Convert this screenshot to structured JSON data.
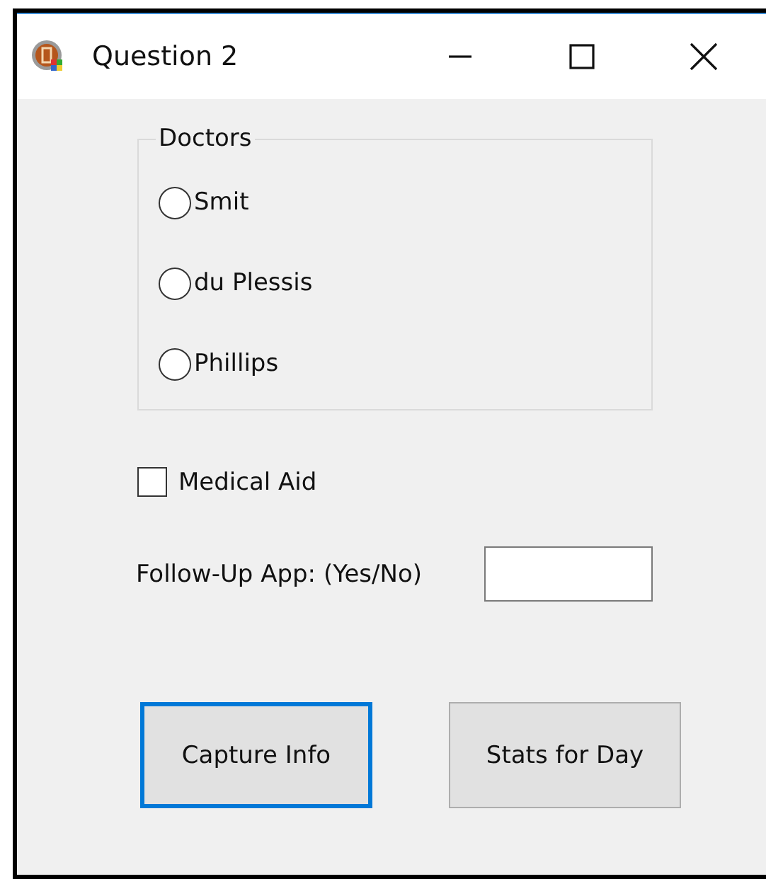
{
  "window": {
    "title": "Question 2"
  },
  "doctors": {
    "label": "Doctors",
    "options": [
      {
        "label": "Smit",
        "selected": false
      },
      {
        "label": "du Plessis",
        "selected": false
      },
      {
        "label": "Phillips",
        "selected": false
      }
    ]
  },
  "medical_aid": {
    "label": "Medical Aid",
    "checked": false
  },
  "follow_up": {
    "label": "Follow-Up App: (Yes/No)"
  },
  "buttons": [
    {
      "label": "Capture Info",
      "focused": true
    },
    {
      "label": "Stats for Day",
      "focused": false
    }
  ]
}
